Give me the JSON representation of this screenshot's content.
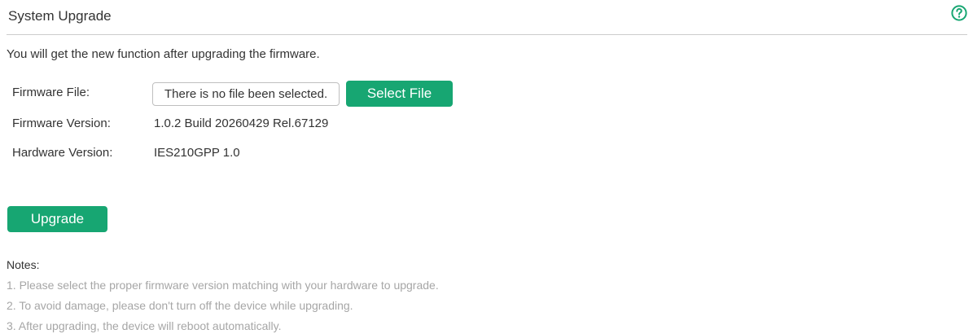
{
  "header": {
    "title": "System Upgrade",
    "help_icon": "question-circle-icon"
  },
  "intro": "You will get the new function after upgrading the firmware.",
  "form": {
    "firmware_file_label": "Firmware File:",
    "file_input_value": "There is no file been selected.",
    "select_file_label": "Select File",
    "firmware_version_label": "Firmware Version:",
    "firmware_version_value": "1.0.2 Build 20260429 Rel.67129",
    "hardware_version_label": "Hardware Version:",
    "hardware_version_value": "IES210GPP 1.0"
  },
  "upgrade_label": "Upgrade",
  "notes": {
    "title": "Notes:",
    "items": [
      "1. Please select the proper firmware version matching with your hardware to upgrade.",
      "2. To avoid damage, please don't turn off the device while upgrading.",
      "3. After upgrading, the device will reboot automatically."
    ]
  },
  "colors": {
    "accent": "#17a672",
    "note_text": "#a6a6a6",
    "divider": "#cccccc"
  }
}
